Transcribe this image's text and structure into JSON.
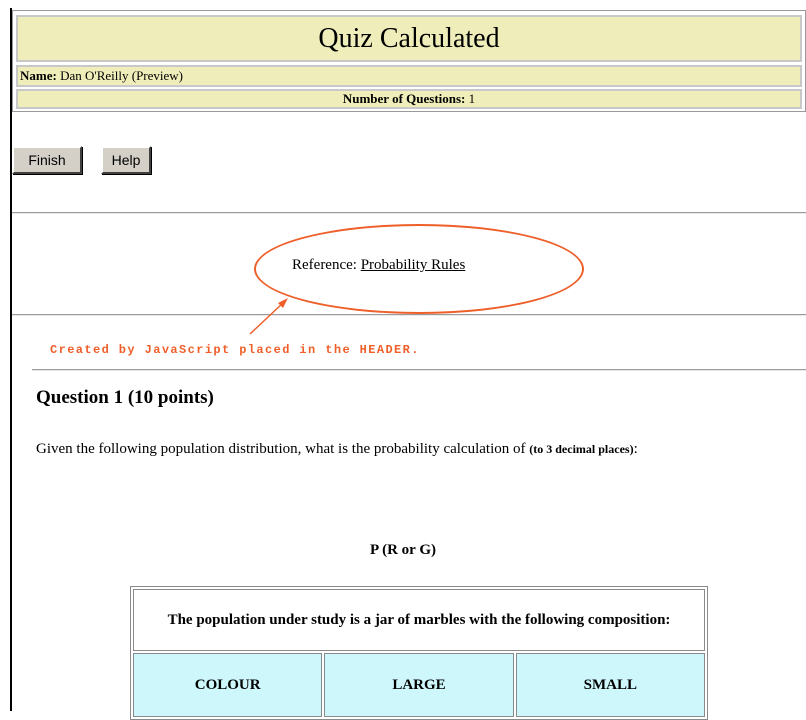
{
  "header": {
    "title": "Quiz Calculated",
    "name_label": "Name:",
    "name_value": "Dan O'Reilly (Preview)",
    "num_label": "Number of Questions:",
    "num_value": "1"
  },
  "buttons": {
    "finish": "Finish",
    "help": "Help"
  },
  "reference": {
    "label": "Reference:",
    "link": "Probability Rules"
  },
  "annotation": {
    "note": "Created by JavaScript placed in the HEADER."
  },
  "question": {
    "heading": "Question 1  (10 points)",
    "text": "Given the following population distribution, what is the probability calculation of",
    "text_bold": "(to 3 decimal places)",
    "text_end": ":",
    "expression": "P (R or G)"
  },
  "table": {
    "caption": "The population under study is a jar of marbles with the following composition:",
    "headers": [
      "COLOUR",
      "LARGE",
      "SMALL"
    ]
  },
  "colors": {
    "header_bg": "#efeeba",
    "annotation": "#ee5f2a",
    "table_header_bg": "#cdf7fb"
  }
}
